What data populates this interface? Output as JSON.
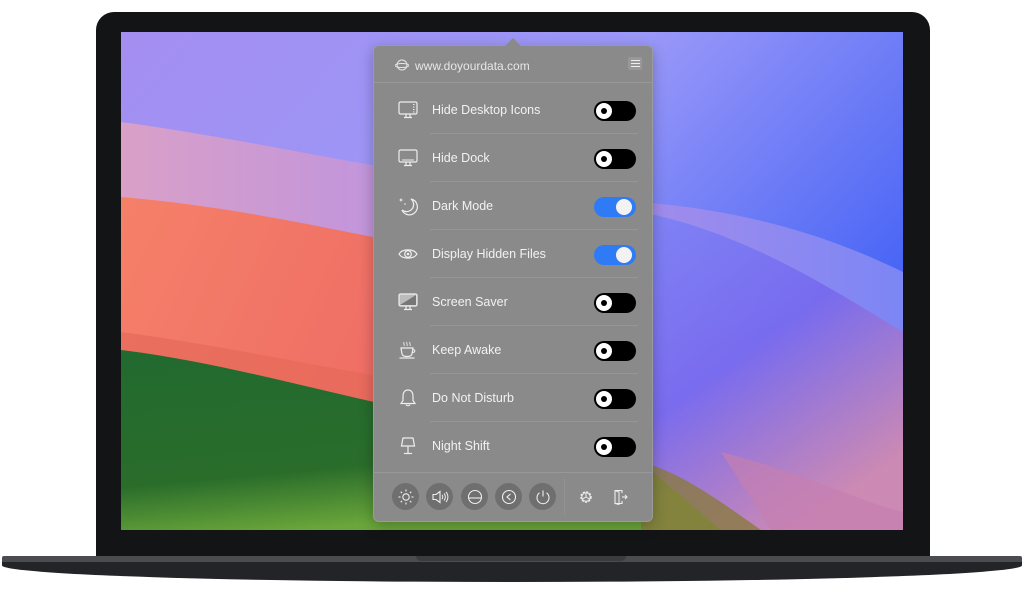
{
  "popup": {
    "header": {
      "site": "www.doyourdata.com",
      "globe_icon": "globe-icon",
      "menu_icon": "hamburger-menu-icon"
    },
    "toggles": [
      {
        "label": "Hide Desktop Icons",
        "icon": "desktop-icons-icon",
        "on": false
      },
      {
        "label": "Hide Dock",
        "icon": "monitor-dock-icon",
        "on": false
      },
      {
        "label": "Dark Mode",
        "icon": "moon-stars-icon",
        "on": true
      },
      {
        "label": "Display Hidden Files",
        "icon": "eye-icon",
        "on": true
      },
      {
        "label": "Screen Saver",
        "icon": "screen-saver-icon",
        "on": false
      },
      {
        "label": "Keep Awake",
        "icon": "coffee-cup-icon",
        "on": false
      },
      {
        "label": "Do Not Disturb",
        "icon": "bell-icon",
        "on": false
      },
      {
        "label": "Night Shift",
        "icon": "lamp-icon",
        "on": false
      }
    ],
    "footer": [
      {
        "name": "brightness-button",
        "icon": "sun-icon"
      },
      {
        "name": "volume-button",
        "icon": "speaker-icon"
      },
      {
        "name": "eject-disk-button",
        "icon": "disk-icon"
      },
      {
        "name": "back-button",
        "icon": "back-arrow-icon"
      },
      {
        "name": "power-button",
        "icon": "power-icon"
      },
      {
        "name": "settings-button",
        "icon": "gear-icon"
      },
      {
        "name": "quit-button",
        "icon": "exit-door-icon"
      }
    ]
  },
  "colors": {
    "toggle_on": "#2f7bf5",
    "toggle_off": "#000000",
    "popup_bg": "#8a8a8a"
  }
}
